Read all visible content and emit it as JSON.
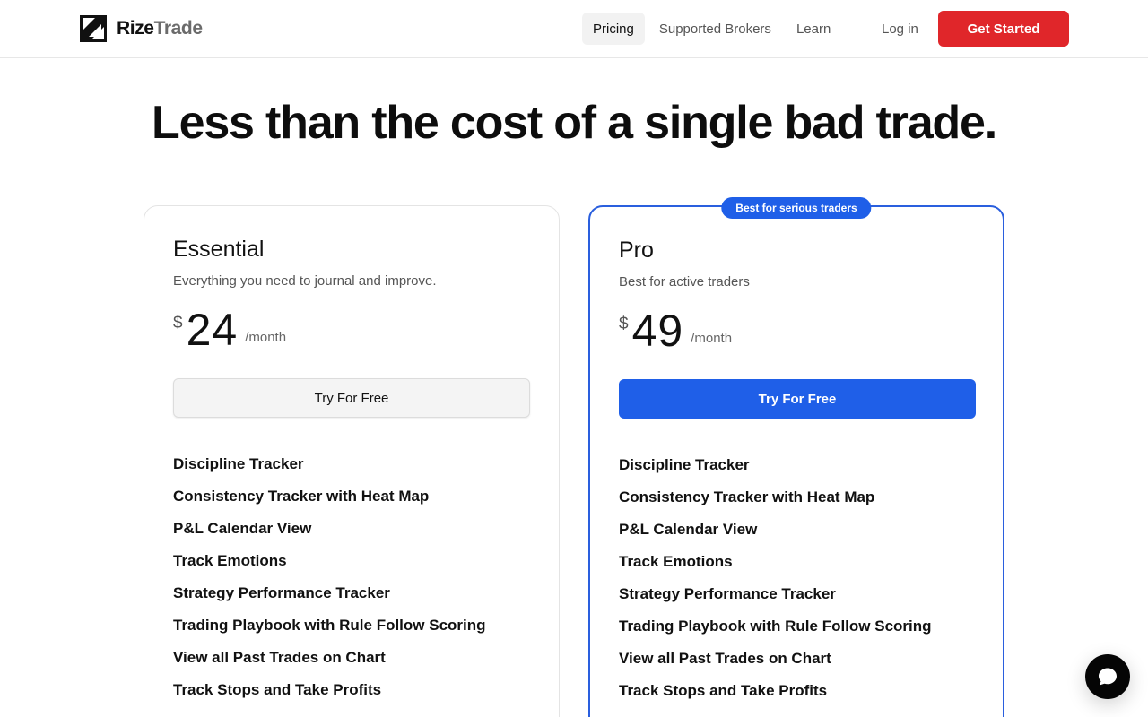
{
  "brand": {
    "name_bold": "Rize",
    "name_light": "Trade"
  },
  "nav": {
    "links": [
      "Pricing",
      "Supported Brokers",
      "Learn"
    ],
    "login": "Log in",
    "cta": "Get Started"
  },
  "headline": "Less than the cost of a single bad trade.",
  "plans": [
    {
      "name": "Essential",
      "description": "Everything you need to journal and improve.",
      "currency": "$",
      "price": "24",
      "period": "/month",
      "button": "Try For Free",
      "features": [
        "Discipline Tracker",
        "Consistency Tracker with Heat Map",
        "P&L Calendar View",
        "Track Emotions",
        "Strategy Performance Tracker",
        "Trading Playbook with Rule Follow Scoring",
        "View all Past Trades on Chart",
        "Track Stops and Take Profits"
      ]
    },
    {
      "name": "Pro",
      "badge": "Best for serious traders",
      "description": "Best for active traders",
      "currency": "$",
      "price": "49",
      "period": "/month",
      "button": "Try For Free",
      "features": [
        "Discipline Tracker",
        "Consistency Tracker with Heat Map",
        "P&L Calendar View",
        "Track Emotions",
        "Strategy Performance Tracker",
        "Trading Playbook with Rule Follow Scoring",
        "View all Past Trades on Chart",
        "Track Stops and Take Profits"
      ]
    }
  ],
  "colors": {
    "accent_red": "#e0262a",
    "accent_blue": "#1f5fe8"
  },
  "icons": {
    "chat": "chat-bubble-icon",
    "logo": "arrow-up-right-logo"
  }
}
